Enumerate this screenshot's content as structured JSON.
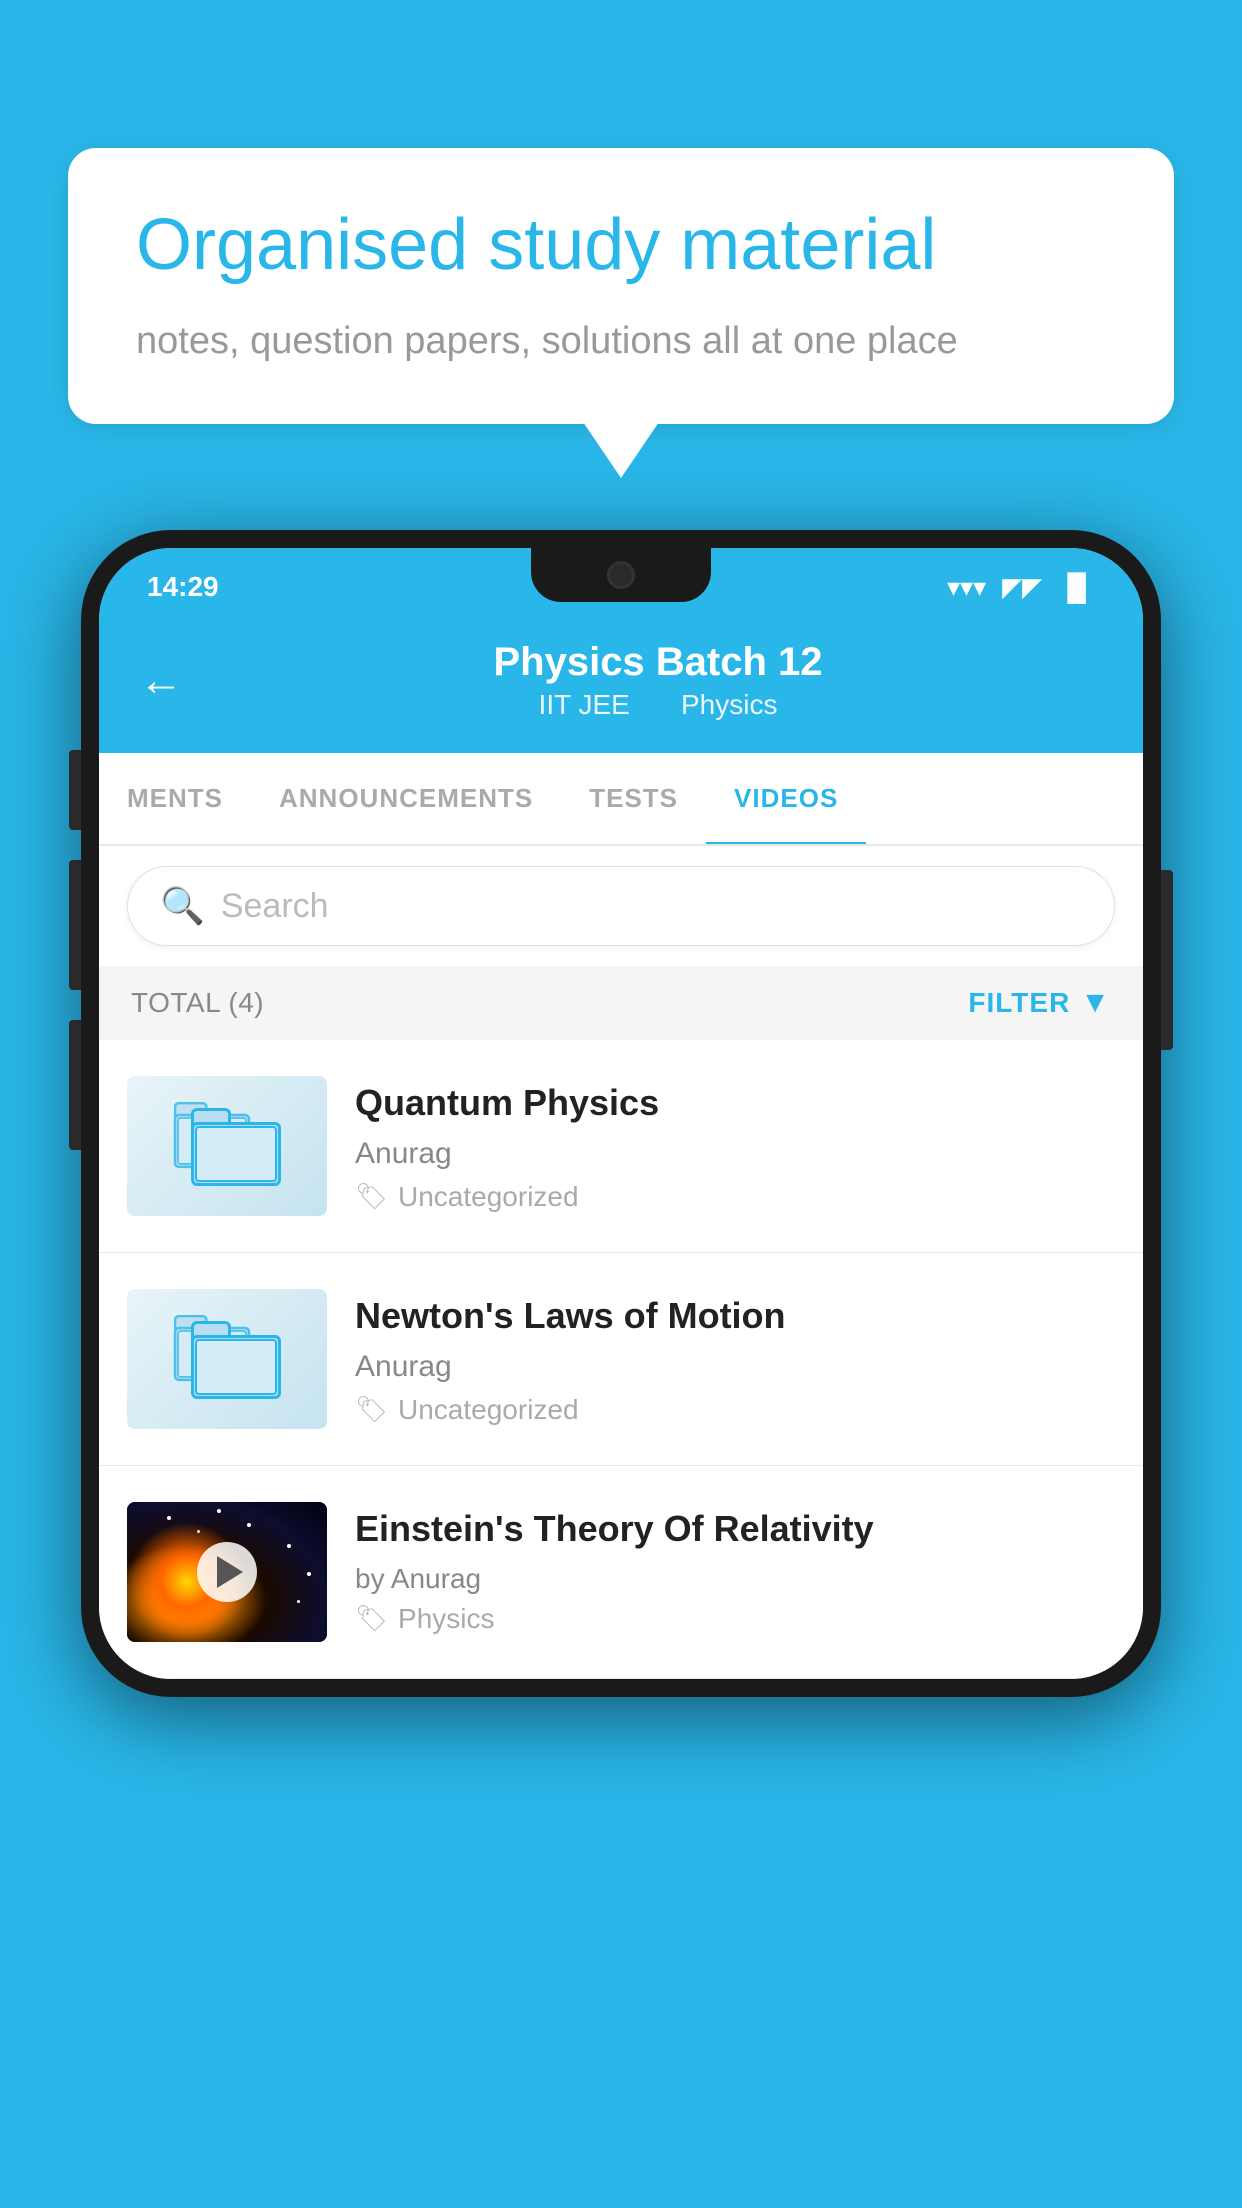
{
  "background_color": "#29b6e8",
  "speech_bubble": {
    "headline": "Organised study material",
    "subtext": "notes, question papers, solutions all at one place"
  },
  "status_bar": {
    "time": "14:29",
    "wifi": "▾",
    "signal": "▲▲",
    "battery": "▐"
  },
  "app_header": {
    "back_label": "←",
    "title": "Physics Batch 12",
    "subtitle_part1": "IIT JEE",
    "subtitle_part2": "Physics"
  },
  "tabs": [
    {
      "label": "MENTS",
      "active": false
    },
    {
      "label": "ANNOUNCEMENTS",
      "active": false
    },
    {
      "label": "TESTS",
      "active": false
    },
    {
      "label": "VIDEOS",
      "active": true
    }
  ],
  "search": {
    "placeholder": "Search"
  },
  "filter_bar": {
    "total_label": "TOTAL (4)",
    "filter_label": "FILTER"
  },
  "videos": [
    {
      "id": "1",
      "title": "Quantum Physics",
      "author": "Anurag",
      "tag": "Uncategorized",
      "has_thumbnail": false
    },
    {
      "id": "2",
      "title": "Newton's Laws of Motion",
      "author": "Anurag",
      "tag": "Uncategorized",
      "has_thumbnail": false
    },
    {
      "id": "3",
      "title": "Einstein's Theory Of Relativity",
      "author": "by Anurag",
      "tag": "Physics",
      "has_thumbnail": true
    }
  ]
}
